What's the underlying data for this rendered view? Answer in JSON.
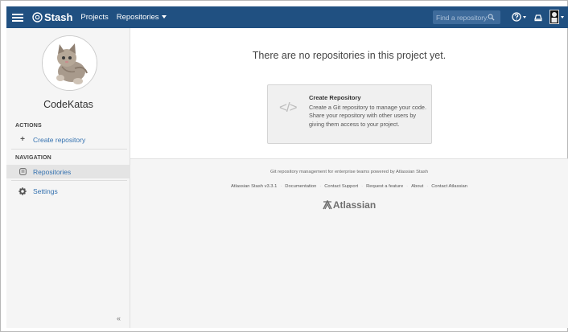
{
  "topbar": {
    "logo_text": "Stash",
    "nav_projects": "Projects",
    "nav_repositories": "Repositories",
    "search_placeholder": "Find a repository..."
  },
  "sidebar": {
    "project_name": "CodeKatas",
    "actions_heading": "ACTIONS",
    "create_repository": "Create repository",
    "navigation_heading": "NAVIGATION",
    "repositories": "Repositories",
    "settings": "Settings",
    "collapse": "«"
  },
  "main": {
    "empty_message": "There are no repositories in this project yet.",
    "card": {
      "icon": "</>",
      "title": "Create Repository",
      "description": "Create a Git repository to manage your code. Share your repository with other users by giving them access to your project."
    }
  },
  "footer": {
    "tagline": "Git repository management for enterprise teams powered by Atlassian Stash",
    "links": [
      "Atlassian Stash v3.3.1",
      "Documentation",
      "Contact Support",
      "Request a feature",
      "About",
      "Contact Atlassian"
    ],
    "brand": "Atlassian"
  },
  "colors": {
    "topbar": "#205081",
    "link": "#3572b0"
  }
}
